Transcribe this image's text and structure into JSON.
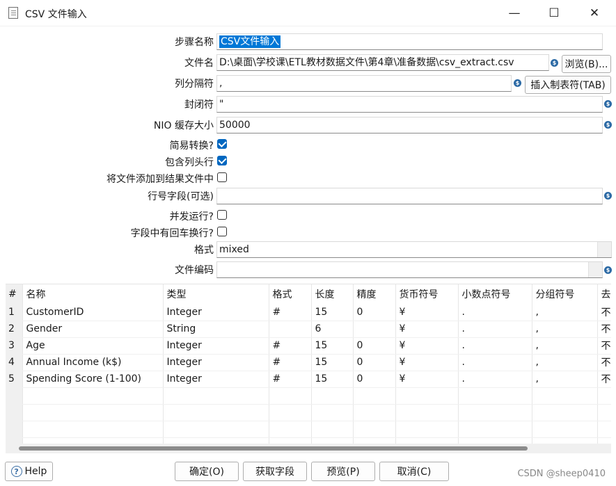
{
  "window": {
    "title": "CSV 文件输入",
    "minimize_icon": "—",
    "maximize_icon": "☐",
    "close_icon": "✕"
  },
  "form": {
    "step_name": {
      "label": "步骤名称",
      "value": "CSV文件输入"
    },
    "filename": {
      "label": "文件名",
      "value": "D:\\桌面\\学校课\\ETL教材数据文件\\第4章\\准备数据\\csv_extract.csv",
      "browse": "浏览(B)..."
    },
    "delimiter": {
      "label": "列分隔符",
      "value": ",",
      "insert_tab": "插入制表符(TAB)"
    },
    "enclosure": {
      "label": "封闭符",
      "value": "\""
    },
    "nio_buffer": {
      "label": "NIO 缓存大小",
      "value": "50000"
    },
    "lazy_conversion": {
      "label": "简易转换?",
      "checked": true
    },
    "header_row": {
      "label": "包含列头行",
      "checked": true
    },
    "add_to_result": {
      "label": "将文件添加到结果文件中",
      "checked": false
    },
    "rownum_field": {
      "label": "行号字段(可选)",
      "value": ""
    },
    "parallel": {
      "label": "并发运行?",
      "checked": false
    },
    "newline_in_field": {
      "label": "字段中有回车换行?",
      "checked": false
    },
    "format": {
      "label": "格式",
      "value": "mixed"
    },
    "encoding": {
      "label": "文件编码",
      "value": ""
    },
    "var_icon": "$"
  },
  "table": {
    "headers": [
      "#",
      "名称",
      "类型",
      "格式",
      "长度",
      "精度",
      "货币符号",
      "小数点符号",
      "分组符号",
      "去除"
    ],
    "rows": [
      [
        "1",
        "CustomerID",
        "Integer",
        "#",
        "15",
        "0",
        "¥",
        ".",
        ",",
        "不去"
      ],
      [
        "2",
        "Gender",
        "String",
        "",
        "6",
        "",
        "¥",
        ".",
        ",",
        "不去"
      ],
      [
        "3",
        "Age",
        "Integer",
        "#",
        "15",
        "0",
        "¥",
        ".",
        ",",
        "不去"
      ],
      [
        "4",
        "Annual Income (k$)",
        "Integer",
        "#",
        "15",
        "0",
        "¥",
        ".",
        ",",
        "不去"
      ],
      [
        "5",
        "Spending Score (1-100)",
        "Integer",
        "#",
        "15",
        "0",
        "¥",
        ".",
        ",",
        "不去"
      ],
      [
        "",
        "",
        "",
        "",
        "",
        "",
        "",
        "",
        "",
        ""
      ],
      [
        "",
        "",
        "",
        "",
        "",
        "",
        "",
        "",
        "",
        ""
      ],
      [
        "",
        "",
        "",
        "",
        "",
        "",
        "",
        "",
        "",
        ""
      ],
      [
        "",
        "",
        "",
        "",
        "",
        "",
        "",
        "",
        "",
        ""
      ]
    ]
  },
  "footer": {
    "help_label": "Help",
    "help_icon": "?",
    "ok": "确定(O)",
    "get_fields": "获取字段",
    "preview": "预览(P)",
    "cancel": "取消(C)",
    "watermark": "CSDN @sheep0410"
  }
}
